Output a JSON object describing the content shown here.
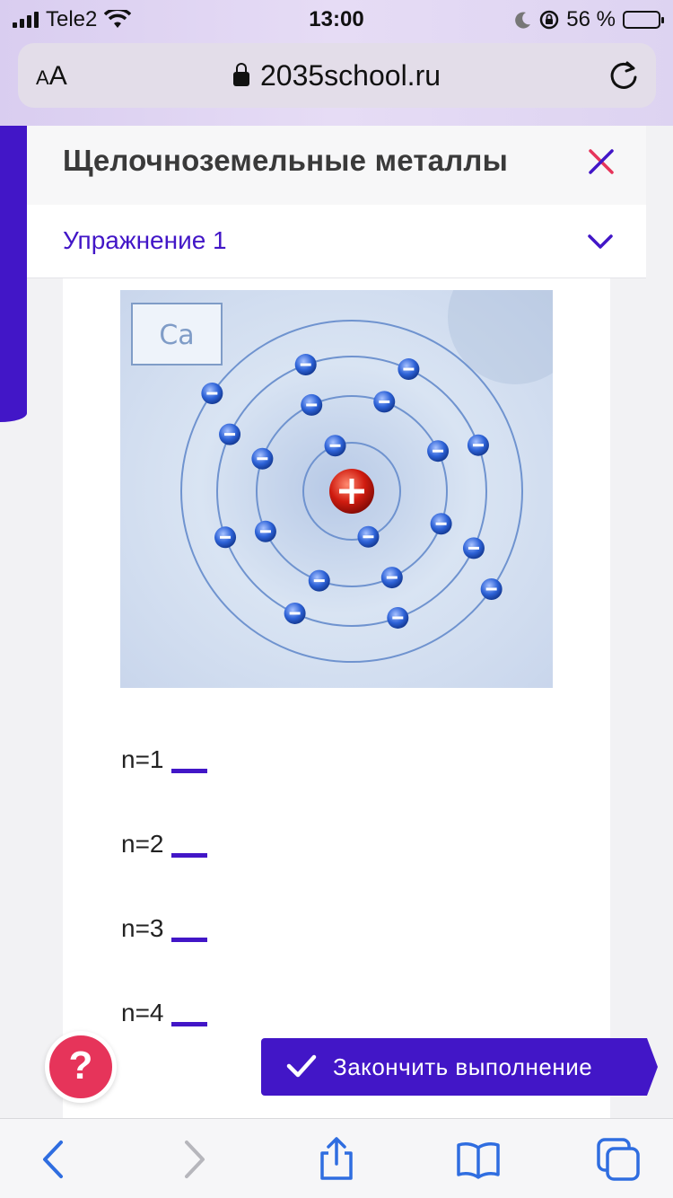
{
  "status_bar": {
    "carrier": "Tele2",
    "time": "13:00",
    "battery_percent": "56 %",
    "battery_level": 0.56
  },
  "browser": {
    "text_size_label": "AA",
    "url": "2035school.ru"
  },
  "page": {
    "title": "Щелочноземельные металлы",
    "exercise_label": "Упражнение 1"
  },
  "atom_image": {
    "element_symbol": "Ca",
    "shell_electron_counts": [
      2,
      8,
      8,
      2
    ]
  },
  "answers": [
    {
      "label": "n=1",
      "value": ""
    },
    {
      "label": "n=2",
      "value": ""
    },
    {
      "label": "n=3",
      "value": ""
    },
    {
      "label": "n=4",
      "value": ""
    }
  ],
  "help_button": {
    "label": "?"
  },
  "finish_button": {
    "label": "Закончить выполнение"
  },
  "colors": {
    "accent": "#4216c7",
    "help": "#e6345a",
    "close_icon_left": "#e6345a",
    "close_icon_right": "#4216c7"
  },
  "toolbar_icons": [
    "back-icon",
    "forward-icon",
    "share-icon",
    "bookmarks-icon",
    "tabs-icon"
  ]
}
